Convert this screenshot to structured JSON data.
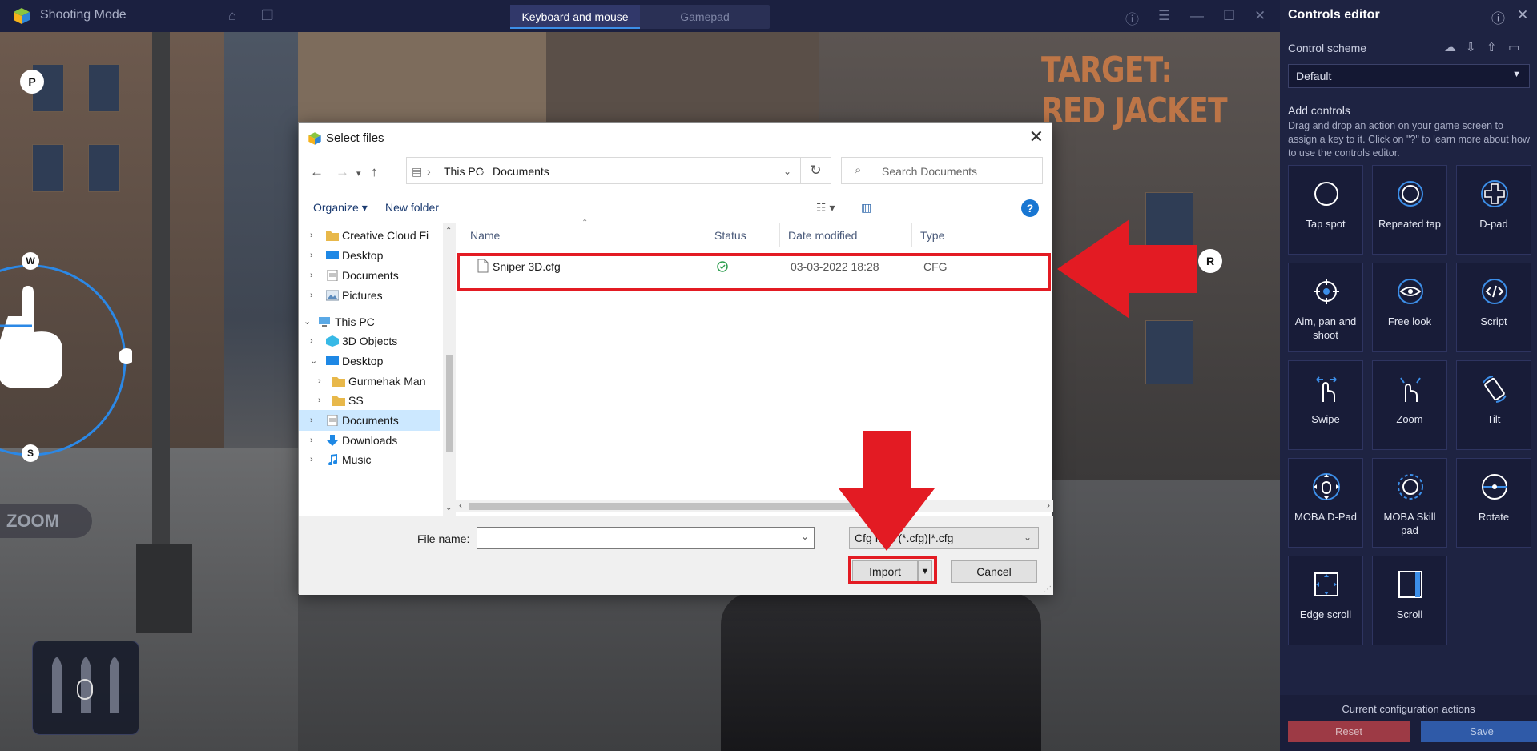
{
  "app": {
    "title": "Shooting Mode",
    "mode_tabs": [
      "Keyboard and mouse",
      "Gamepad"
    ]
  },
  "game": {
    "banner": "TARGET: RED JACKET",
    "key_badges": [
      "P",
      "W",
      "S",
      "R"
    ],
    "zoom_label": "ZOOM"
  },
  "dialog": {
    "title": "Select files",
    "path": [
      "This PC",
      "Documents"
    ],
    "search_placeholder": "Search Documents",
    "organize": "Organize",
    "new_folder": "New folder",
    "help": "?",
    "tree": [
      {
        "label": "Creative Cloud Fi",
        "level": 1,
        "icon": "folder-icon"
      },
      {
        "label": "Desktop",
        "level": 1,
        "icon": "desktop-icon"
      },
      {
        "label": "Documents",
        "level": 1,
        "icon": "documents-icon"
      },
      {
        "label": "Pictures",
        "level": 1,
        "icon": "pictures-icon"
      },
      {
        "label": "This PC",
        "level": 0,
        "icon": "computer-icon"
      },
      {
        "label": "3D Objects",
        "level": 1,
        "icon": "3d-objects-icon"
      },
      {
        "label": "Desktop",
        "level": 1,
        "icon": "desktop-icon"
      },
      {
        "label": "Gurmehak Man",
        "level": 2,
        "icon": "folder-icon"
      },
      {
        "label": "SS",
        "level": 2,
        "icon": "folder-icon"
      },
      {
        "label": "Documents",
        "level": 1,
        "icon": "documents-icon"
      },
      {
        "label": "Downloads",
        "level": 1,
        "icon": "downloads-icon"
      },
      {
        "label": "Music",
        "level": 1,
        "icon": "music-icon"
      }
    ],
    "columns": [
      "Name",
      "Status",
      "Date modified",
      "Type"
    ],
    "files": [
      {
        "name": "Sniper 3D.cfg",
        "status": "synced",
        "date": "03-03-2022 18:28",
        "type": "CFG"
      }
    ],
    "file_name_label": "File name:",
    "file_name_value": "",
    "file_type": "Cfg files (*.cfg)|*.cfg",
    "import": "Import",
    "cancel": "Cancel"
  },
  "panel": {
    "title": "Controls editor",
    "scheme_label": "Control scheme",
    "scheme_value": "Default",
    "add_title": "Add controls",
    "add_desc": "Drag and drop an action on your game screen to assign a key to it. Click on \"?\" to learn more about how to use the controls editor.",
    "tiles": [
      "Tap spot",
      "Repeated tap",
      "D-pad",
      "Aim, pan and shoot",
      "Free look",
      "Script",
      "Swipe",
      "Zoom",
      "Tilt",
      "MOBA D-Pad",
      "MOBA Skill pad",
      "Rotate",
      "Edge scroll",
      "Scroll"
    ],
    "footer_title": "Current configuration actions",
    "reset": "Reset",
    "save": "Save"
  },
  "colors": {
    "accent": "#3c8ee8",
    "annotation": "#e31b23",
    "panel_bg": "#1e2342",
    "reset_btn": "#9d3a45",
    "save_btn": "#2f5aa8"
  }
}
